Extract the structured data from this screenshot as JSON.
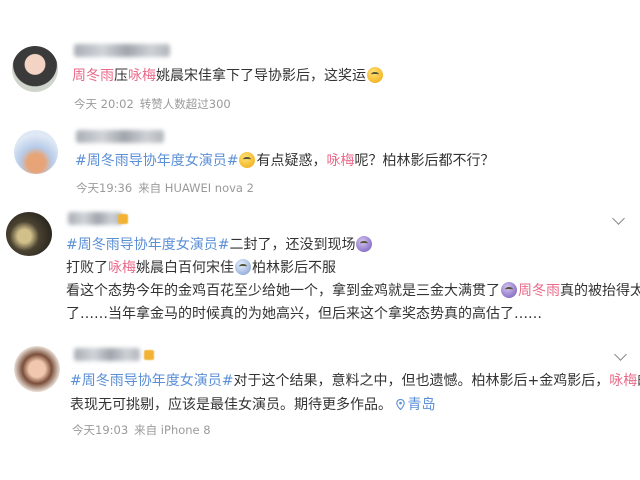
{
  "colors": {
    "highlight": "#eb6a8a",
    "topic": "#5b8fd6",
    "meta": "#9a9a9a",
    "text": "#333333"
  },
  "posts": [
    {
      "line1": {
        "a": "周冬雨",
        "b": "压",
        "c": "咏梅",
        "d": "姚晨宋佳拿下了导协影后，这奖运"
      },
      "meta": {
        "time": "今天 20:02",
        "extra": "转赞人数超过300"
      }
    },
    {
      "line1": {
        "topic": "#周冬雨导协年度女演员#",
        "b": "有点疑惑，",
        "c": "咏梅",
        "d": "呢？柏林影后都不行？"
      },
      "meta": {
        "time": "今天19:36",
        "source": "来自 HUAWEI nova 2"
      }
    },
    {
      "line1": {
        "topic": "#周冬雨导协年度女演员#",
        "b": "二封了，还没到现场"
      },
      "line2": {
        "a": "打败了",
        "b": "咏梅",
        "c": "姚晨白百何宋佳",
        "d": "柏林影后不服"
      },
      "line3": {
        "a": "看这个态势今年的金鸡百花至少给她一个，拿到金鸡就是三金大满贯了",
        "b": "周冬雨",
        "c": "真的被抬得太高"
      },
      "line4": {
        "a": "了……当年拿金马的时候真的为她高兴，但后来这个拿奖态势真的高估了……"
      }
    },
    {
      "line1": {
        "topic": "#周冬雨导协年度女演员#",
        "b": "对于这个结果，意料之中，但也遗憾。柏林影后+金鸡影后，",
        "c": "咏梅",
        "d": "的"
      },
      "line2": {
        "a": "表现无可挑剔，应该是最佳女演员。期待更多作品。",
        "loc": "青岛"
      },
      "meta": {
        "time": "今天19:03",
        "source": "来自 iPhone 8"
      }
    }
  ]
}
